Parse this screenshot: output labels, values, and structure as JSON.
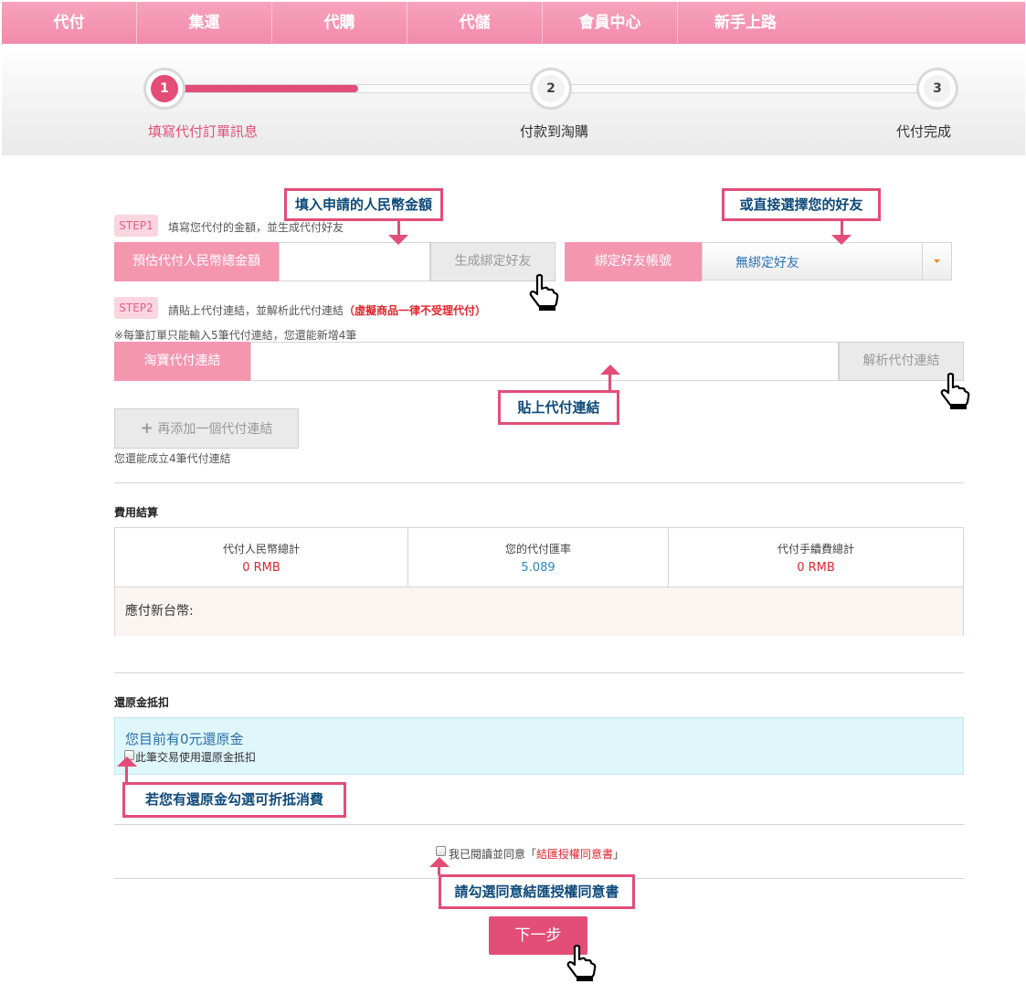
{
  "nav": [
    "代付",
    "集運",
    "代購",
    "代儲",
    "會員中心",
    "新手上路"
  ],
  "progress": {
    "steps": [
      {
        "num": "1",
        "label": "填寫代付訂單訊息"
      },
      {
        "num": "2",
        "label": "付款到淘購"
      },
      {
        "num": "3",
        "label": "代付完成"
      }
    ]
  },
  "step1": {
    "badge": "STEP1",
    "desc": "填寫您代付的金額，並生成代付好友",
    "amount_label": "預估代付人民幣總金額",
    "generate_btn": "生成綁定好友",
    "bind_label": "綁定好友帳號",
    "bind_select": "無綁定好友"
  },
  "step2": {
    "badge": "STEP2",
    "desc": "請貼上代付連結，並解析此代付連結",
    "warning": "（虛擬商品一律不受理代付）",
    "note": "※每筆訂單只能輸入5筆代付連結，您還能新增4筆",
    "link_label": "淘寶代付連結",
    "parse_btn": "解析代付連結",
    "add_btn": "再添加一個代付連結",
    "add_note": "您還能成立4筆代付連結"
  },
  "fees": {
    "heading": "費用結算",
    "cols": [
      {
        "label": "代付人民幣總計",
        "value": "0 RMB",
        "color": "#e0252d"
      },
      {
        "label": "您的代付匯率",
        "value": "5.089",
        "color": "#2a86c5"
      },
      {
        "label": "代付手續費總計",
        "value": "0 RMB",
        "color": "#e0252d"
      }
    ],
    "total_label": "應付新台幣:"
  },
  "cashback": {
    "heading": "還原金抵扣",
    "amount_text": "您目前有0元還原金",
    "checkbox_label": "此筆交易使用還原金抵扣"
  },
  "agreement": {
    "prefix": "我已閱讀並同意「",
    "link": "結匯授權同意書",
    "suffix": "」"
  },
  "next_btn": "下一步",
  "callouts": {
    "amount": "填入申請的人民幣金額",
    "friend": "或直接選擇您的好友",
    "paste": "貼上代付連結",
    "cashback": "若您有還原金勾選可折抵消費",
    "agree": "請勾選同意結匯授權同意書"
  },
  "colors": {
    "brand_pink": "#e24e78",
    "nav_pink": "#f28bab",
    "callout_text": "#0d4a7a"
  }
}
